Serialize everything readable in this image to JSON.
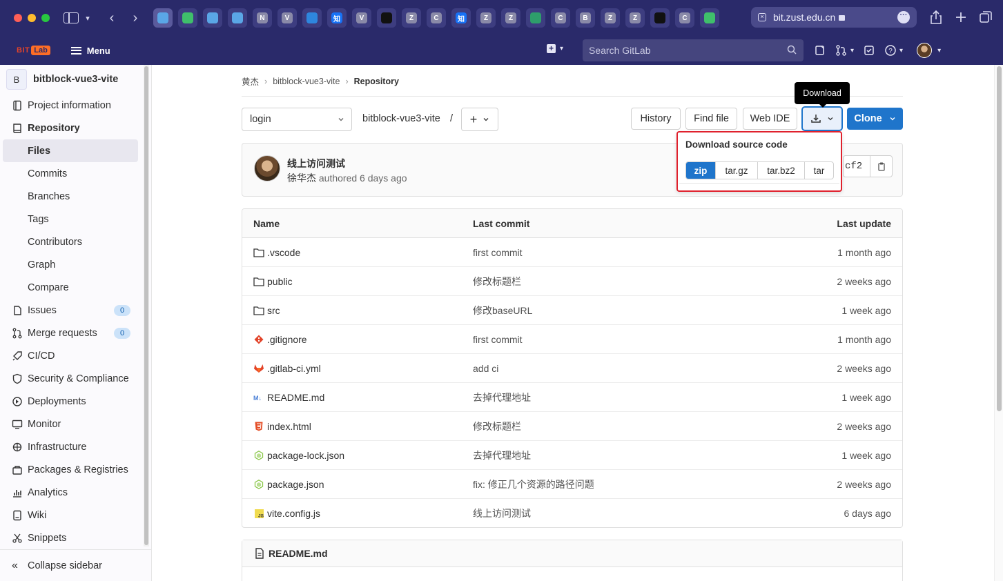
{
  "browser": {
    "url": "bit.zust.edu.cn",
    "tabs": [
      {
        "glyph": "",
        "color": "#5aa6e6"
      },
      {
        "glyph": "",
        "color": "#3fbf6b"
      },
      {
        "glyph": "",
        "color": "#5aa6e6"
      },
      {
        "glyph": "",
        "color": "#5aa6e6"
      },
      {
        "glyph": "N",
        "color": "#8a8aa8"
      },
      {
        "glyph": "V",
        "color": "#8a8aa8"
      },
      {
        "glyph": "",
        "color": "#2e86de"
      },
      {
        "glyph": "知",
        "color": "#1772f6"
      },
      {
        "glyph": "V",
        "color": "#8a8aa8"
      },
      {
        "glyph": "",
        "color": "#111111"
      },
      {
        "glyph": "Z",
        "color": "#8a8aa8"
      },
      {
        "glyph": "C",
        "color": "#8a8aa8"
      },
      {
        "glyph": "知",
        "color": "#1772f6"
      },
      {
        "glyph": "Z",
        "color": "#8a8aa8"
      },
      {
        "glyph": "Z",
        "color": "#8a8aa8"
      },
      {
        "glyph": "",
        "color": "#2e9e6b"
      },
      {
        "glyph": "C",
        "color": "#8a8aa8"
      },
      {
        "glyph": "B",
        "color": "#8a8aa8"
      },
      {
        "glyph": "Z",
        "color": "#8a8aa8"
      },
      {
        "glyph": "Z",
        "color": "#8a8aa8"
      },
      {
        "glyph": "",
        "color": "#111111"
      },
      {
        "glyph": "C",
        "color": "#8a8aa8"
      },
      {
        "glyph": "",
        "color": "#3fbf6b"
      }
    ]
  },
  "header": {
    "logo_bit": "BIT",
    "logo_lab": "Lab",
    "menu_label": "Menu",
    "search_placeholder": "Search GitLab"
  },
  "sidebar": {
    "project_initial": "B",
    "project_name": "bitblock-vue3-vite",
    "items": [
      {
        "label": "Project information",
        "icon": "info-icon"
      },
      {
        "label": "Repository",
        "icon": "book-icon"
      },
      {
        "label": "Issues",
        "icon": "issues-icon",
        "badge": "0"
      },
      {
        "label": "Merge requests",
        "icon": "merge-request-icon",
        "badge": "0"
      },
      {
        "label": "CI/CD",
        "icon": "rocket-icon"
      },
      {
        "label": "Security & Compliance",
        "icon": "shield-icon"
      },
      {
        "label": "Deployments",
        "icon": "deployments-icon"
      },
      {
        "label": "Monitor",
        "icon": "monitor-icon"
      },
      {
        "label": "Infrastructure",
        "icon": "cloud-icon"
      },
      {
        "label": "Packages & Registries",
        "icon": "package-icon"
      },
      {
        "label": "Analytics",
        "icon": "chart-icon"
      },
      {
        "label": "Wiki",
        "icon": "wiki-icon"
      },
      {
        "label": "Snippets",
        "icon": "snippet-icon"
      }
    ],
    "repo_subitems": [
      "Files",
      "Commits",
      "Branches",
      "Tags",
      "Contributors",
      "Graph",
      "Compare"
    ],
    "collapse_label": "Collapse sidebar"
  },
  "breadcrumb": [
    "黄杰",
    "bitblock-vue3-vite",
    "Repository"
  ],
  "toolbar": {
    "branch": "login",
    "path_name": "bitblock-vue3-vite",
    "path_slash": "/",
    "history": "History",
    "find_file": "Find file",
    "web_ide": "Web IDE",
    "download_tooltip": "Download",
    "clone": "Clone"
  },
  "download_menu": {
    "title": "Download source code",
    "formats": [
      "zip",
      "tar.gz",
      "tar.bz2",
      "tar"
    ]
  },
  "last_commit": {
    "title": "线上访问测试",
    "author": "徐华杰",
    "authored_text": "authored 6 days ago",
    "sha_visible": "cf2"
  },
  "file_table": {
    "headers": {
      "name": "Name",
      "commit": "Last commit",
      "date": "Last update"
    },
    "rows": [
      {
        "name": ".vscode",
        "icon": "folder-icon",
        "commit": "first commit",
        "date": "1 month ago"
      },
      {
        "name": "public",
        "icon": "folder-icon",
        "commit": "修改标题栏",
        "date": "2 weeks ago"
      },
      {
        "name": "src",
        "icon": "folder-icon",
        "commit": "修改baseURL",
        "date": "1 week ago"
      },
      {
        "name": ".gitignore",
        "icon": "git-icon",
        "commit": "first commit",
        "date": "1 month ago"
      },
      {
        "name": ".gitlab-ci.yml",
        "icon": "gitlab-icon",
        "commit": "add ci",
        "date": "2 weeks ago"
      },
      {
        "name": "README.md",
        "icon": "markdown-icon",
        "commit": "去掉代理地址",
        "date": "1 week ago"
      },
      {
        "name": "index.html",
        "icon": "html-icon",
        "commit": "修改标题栏",
        "date": "2 weeks ago"
      },
      {
        "name": "package-lock.json",
        "icon": "node-icon",
        "commit": "去掉代理地址",
        "date": "1 week ago"
      },
      {
        "name": "package.json",
        "icon": "node-icon",
        "commit": "fix: 修正几个资源的路径问题",
        "date": "2 weeks ago"
      },
      {
        "name": "vite.config.js",
        "icon": "js-icon",
        "commit": "线上访问测试",
        "date": "6 days ago"
      }
    ]
  },
  "readme": {
    "title": "README.md"
  },
  "colors": {
    "accent": "#1f75cb",
    "header_bg": "#2a2a6a",
    "highlight": "#e0212d"
  }
}
